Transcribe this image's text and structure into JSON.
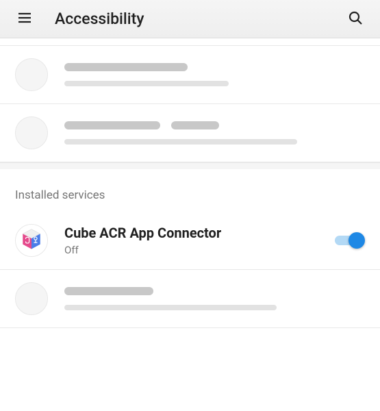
{
  "header": {
    "title": "Accessibility"
  },
  "section": {
    "installed_services": "Installed services"
  },
  "app": {
    "name": "Cube ACR App Connector",
    "status": "Off",
    "toggle_on": true
  },
  "colors": {
    "accent": "#1E88E5",
    "cube_pink": "#E54A8C",
    "cube_blue": "#4B7DE8"
  }
}
